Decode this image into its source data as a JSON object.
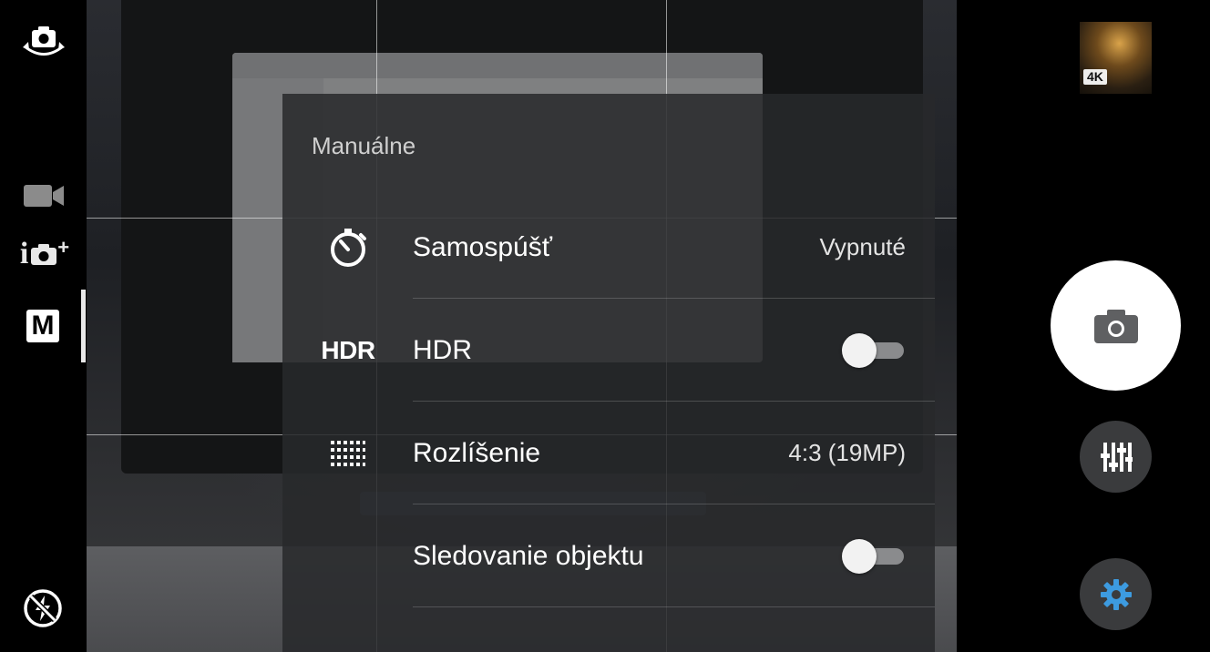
{
  "left_bar": {
    "switch_camera_icon": "camera-switch-icon",
    "video_icon": "video-camera-icon",
    "superior_auto_label": "i",
    "superior_auto_plus": "+",
    "manual_label": "M",
    "flash_icon": "flash-auto-icon"
  },
  "settings": {
    "title": "Manuálne",
    "rows": [
      {
        "icon": "self-timer-icon",
        "label": "Samospúšť",
        "value": "Vypnuté"
      },
      {
        "icon": "hdr-icon",
        "icon_text": "HDR",
        "label": "HDR",
        "toggle_on": false
      },
      {
        "icon": "resolution-grid-icon",
        "label": "Rozlíšenie",
        "value": "4:3 (19MP)"
      },
      {
        "icon": "",
        "label": "Sledovanie objektu",
        "toggle_on": false
      }
    ]
  },
  "right_bar": {
    "thumbnail_badge": "4K",
    "shutter_icon": "camera-icon",
    "manual_settings_icon": "sliders-icon",
    "settings_icon": "gear-icon",
    "settings_accent": "#3d9be0"
  }
}
